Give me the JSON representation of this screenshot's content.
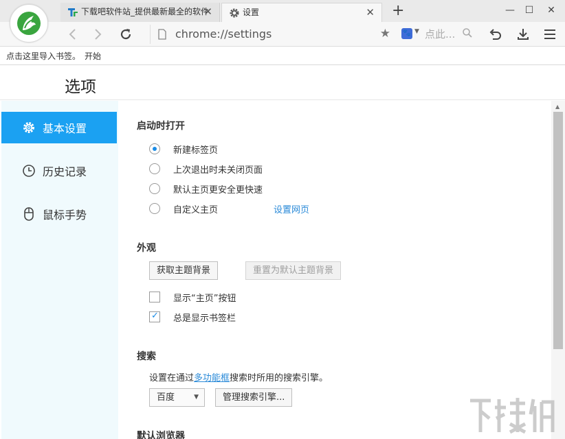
{
  "tabs": [
    {
      "title": "下载吧软件站_提供最新最全的软件",
      "active": false
    },
    {
      "title": "设置",
      "active": true
    }
  ],
  "toolbar": {
    "url": "chrome://settings",
    "search_placeholder": "点此..."
  },
  "bookmarks_bar": {
    "hint": "点击这里导入书签。",
    "start_link": "开始"
  },
  "header": {
    "title": "选项"
  },
  "sidebar": {
    "items": [
      {
        "label": "基本设置",
        "icon": "gear-icon",
        "active": true
      },
      {
        "label": "历史记录",
        "icon": "clock-icon",
        "active": false
      },
      {
        "label": "鼠标手势",
        "icon": "mouse-icon",
        "active": false
      }
    ]
  },
  "startup": {
    "title": "启动时打开",
    "options": [
      {
        "label": "新建标签页",
        "checked": true
      },
      {
        "label": "上次退出时未关闭页面",
        "checked": false
      },
      {
        "label": "默认主页更安全更快速",
        "checked": false
      },
      {
        "label": "自定义主页",
        "checked": false
      }
    ],
    "set_pages_link": "设置网页"
  },
  "appearance": {
    "title": "外观",
    "get_theme_button": "获取主题背景",
    "reset_theme_button": "重置为默认主题背景",
    "show_home_button": "显示“主页”按钮",
    "show_home_checked": false,
    "always_show_bookmarks": "总是显示书签栏",
    "always_show_bookmarks_checked": true
  },
  "search": {
    "title": "搜索",
    "desc_prefix": "设置在通过",
    "desc_link": "多功能框",
    "desc_suffix": "搜索时所用的搜索引擎。",
    "engine_selected": "百度",
    "manage_button": "管理搜索引擎..."
  },
  "default_browser": {
    "title": "默认浏览器"
  },
  "colors": {
    "accent": "#1ba1f2",
    "sidebar_bg": "#f0fafd",
    "link": "#2a8ad8"
  }
}
